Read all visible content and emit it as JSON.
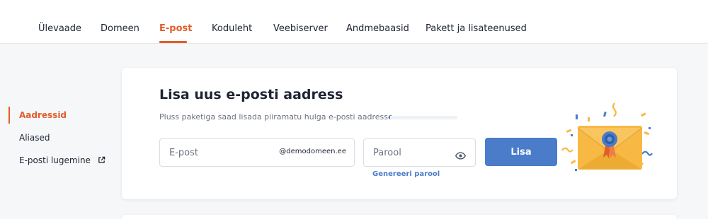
{
  "tabs": [
    {
      "label": "Ülevaade",
      "active": false
    },
    {
      "label": "Domeen",
      "active": false
    },
    {
      "label": "E-post",
      "active": true
    },
    {
      "label": "Koduleht",
      "active": false
    },
    {
      "label": "Veebiserver",
      "active": false
    },
    {
      "label": "Andmebaasid",
      "active": false
    },
    {
      "label": "Pakett ja lisateenused",
      "active": false
    }
  ],
  "sidebar": {
    "items": [
      {
        "label": "Aadressid",
        "active": true
      },
      {
        "label": "Aliased",
        "active": false
      },
      {
        "label": "E-posti lugemine",
        "active": false,
        "icon": "external-link-icon"
      }
    ]
  },
  "form": {
    "title": "Lisa uus e-posti aadress",
    "subtitle": "Pluss paketiga saad lisada piiramatu hulga e-posti aadresse",
    "usage_progress": 0.02,
    "email_placeholder": "E-post",
    "email_value": "",
    "domain_suffix": "@demodomeen.ee",
    "password_placeholder": "Parool",
    "password_value": "",
    "password_icon": "eye-icon",
    "add_label": "Lisa",
    "generate_label": "Genereeri parool",
    "illustration": "envelope-with-badge-confetti"
  },
  "colors": {
    "accent": "#e35d2a",
    "primary": "#4a7cc9",
    "envelope": "#f7b844"
  }
}
